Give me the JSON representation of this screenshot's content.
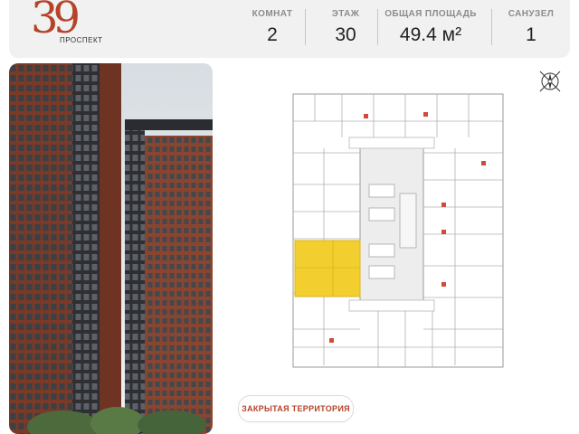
{
  "brand": {
    "logo_number": "39",
    "logo_subtitle": "ПРОСПЕКТ",
    "accent_color": "#b5432a"
  },
  "stats": [
    {
      "label": "КОМНАТ",
      "value": "2"
    },
    {
      "label": "ЭТАЖ",
      "value": "30"
    },
    {
      "label": "ОБЩАЯ ПЛОЩАДЬ",
      "value": "49.4 м²"
    },
    {
      "label": "САНУЗЕЛ",
      "value": "1"
    }
  ],
  "plan": {
    "highlight_color": "#f2cf2e",
    "compass_icon": "compass-icon"
  },
  "feature_button": {
    "label": "ЗАКРЫТАЯ ТЕРРИТОРИЯ"
  }
}
